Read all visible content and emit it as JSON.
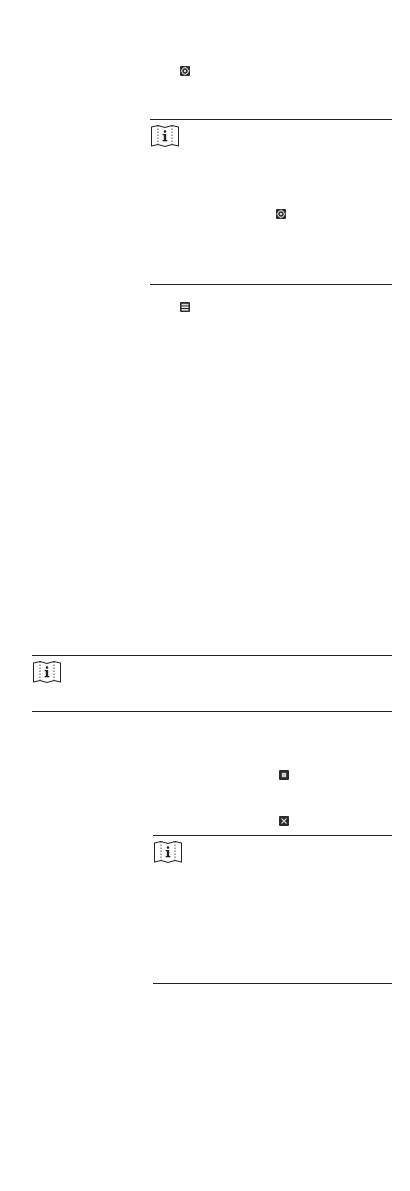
{
  "page": {
    "background": "#ffffff",
    "ink": "#222222"
  },
  "icons": {
    "gear_a": "gear-icon",
    "gear_b": "gear-icon",
    "list": "list-icon",
    "dot": "stop-icon",
    "close": "close-icon",
    "note": "note-book-icon"
  },
  "notes": [
    {
      "id": "note-1"
    },
    {
      "id": "note-2"
    },
    {
      "id": "note-3"
    }
  ]
}
